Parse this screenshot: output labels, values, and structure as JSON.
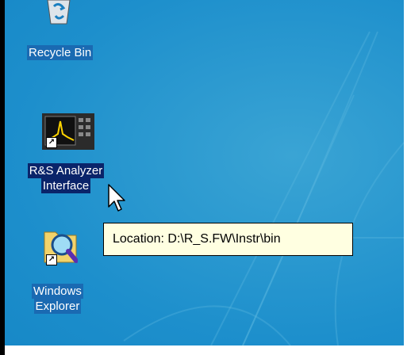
{
  "desktop": {
    "icons": [
      {
        "label": "Recycle Bin",
        "icon": "recycle-bin-icon"
      },
      {
        "label_line1": "R&S Analyzer",
        "label_line2": "Interface",
        "icon": "spectrum-analyzer-icon",
        "selected": true
      },
      {
        "label_line1": "Windows",
        "label_line2": "Explorer",
        "icon": "folder-magnifier-icon"
      }
    ]
  },
  "tooltip": {
    "text": "Location: D:\\R_S.FW\\Instr\\bin"
  },
  "colors": {
    "desktop": "#1d8fcc",
    "selection": "#0a246a",
    "tooltip_bg": "#ffffe1"
  }
}
